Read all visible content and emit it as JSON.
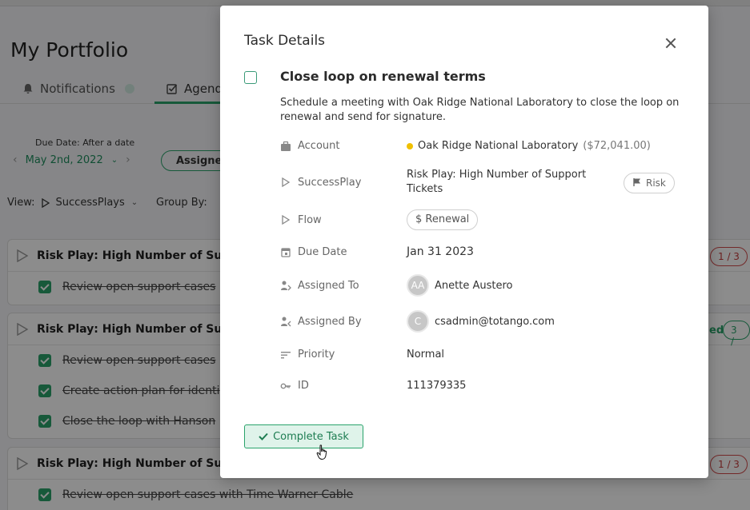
{
  "page": {
    "title": "My Portfolio",
    "tabs": [
      {
        "label": "Notifications",
        "icon": "bell-icon"
      },
      {
        "label": "Agend",
        "icon": "checkbox-icon"
      }
    ],
    "filter_label": "Due Date: After a date",
    "filter_date": "May 2nd, 2022",
    "assigned_pill": "Assigned",
    "view_label": "View:",
    "view_value": "SuccessPlays",
    "group_by_label": "Group By:",
    "cards": [
      {
        "title": "Risk Play: High Number of Suppo",
        "count": "1 / 3",
        "tasks": [
          "Review open support cases"
        ]
      },
      {
        "title": "Risk Play: High Number of Suppo",
        "count": "3 /",
        "status": "ed",
        "tasks": [
          "Review open support cases",
          "Create action plan for identi",
          "Close the loop with Hanson"
        ]
      },
      {
        "title": "Risk Play: High Number of Suppo",
        "count": "1 / 3",
        "tasks": [
          "Review open support cases with Time Warner Cable"
        ]
      }
    ]
  },
  "modal": {
    "title": "Task Details",
    "task_title": "Close loop on renewal terms",
    "description": "Schedule a meeting with Oak Ridge National Laboratory to close the loop on renewal and send for signature.",
    "fields": {
      "account": {
        "label": "Account",
        "value": "Oak Ridge National Laboratory",
        "amount": "($72,041.00)"
      },
      "successplay": {
        "label": "SuccessPlay",
        "value": "Risk Play: High Number of Support Tickets",
        "tag": "Risk"
      },
      "flow": {
        "label": "Flow",
        "value": "$ Renewal"
      },
      "due_date": {
        "label": "Due Date",
        "value": "Jan 31 2023"
      },
      "assigned_to": {
        "label": "Assigned To",
        "initials": "AA",
        "value": "Anette Austero"
      },
      "assigned_by": {
        "label": "Assigned By",
        "initials": "C",
        "value": "csadmin@totango.com"
      },
      "priority": {
        "label": "Priority",
        "value": "Normal"
      },
      "id": {
        "label": "ID",
        "value": "111379335"
      }
    },
    "complete_button": "Complete Task"
  },
  "colors": {
    "accent_green": "#2aa36b",
    "risk_red": "#d24b4b",
    "account_dot": "#f0c000"
  }
}
